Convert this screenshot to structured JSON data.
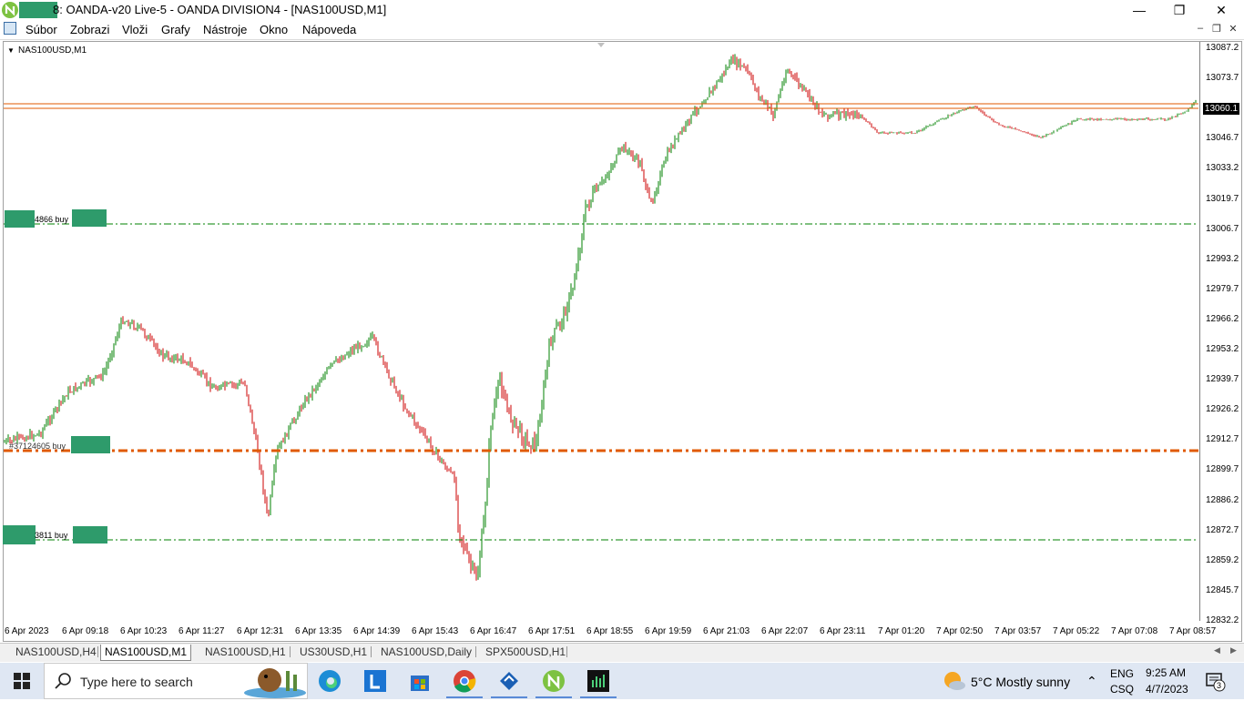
{
  "window": {
    "title": "8: OANDA-v20 Live-5 - OANDA DIVISION4 - [NAS100USD,M1]",
    "minimize": "—",
    "restore": "❐",
    "close": "✕"
  },
  "menu": {
    "items": [
      "Súbor",
      "Zobrazi",
      "Vloži",
      "Grafy",
      "Nástroje",
      "Okno",
      "Nápoveda"
    ],
    "mdi_minimize": "–",
    "mdi_restore": "❐",
    "mdi_close": "✕"
  },
  "chart": {
    "symbol": "NAS100USD,M1",
    "arrow": "▼",
    "current_price": "13060.1",
    "price_axis": [
      "13087.2",
      "13073.7",
      "13060.1",
      "13046.7",
      "13033.2",
      "13019.7",
      "13006.7",
      "12993.2",
      "12979.7",
      "12966.2",
      "12953.2",
      "12939.7",
      "12926.2",
      "12912.7",
      "12899.7",
      "12886.2",
      "12872.7",
      "12859.2",
      "12845.7",
      "12832.2"
    ],
    "time_axis": [
      "6 Apr 2023",
      "6 Apr 09:18",
      "6 Apr 10:23",
      "6 Apr 11:27",
      "6 Apr 12:31",
      "6 Apr 13:35",
      "6 Apr 14:39",
      "6 Apr 15:43",
      "6 Apr 16:47",
      "6 Apr 17:51",
      "6 Apr 18:55",
      "6 Apr 19:59",
      "6 Apr 21:03",
      "6 Apr 22:07",
      "6 Apr 23:11",
      "7 Apr 01:20",
      "7 Apr 02:50",
      "7 Apr 03:57",
      "7 Apr 05:22",
      "7 Apr 07:08",
      "7 Apr 08:57"
    ],
    "orders": [
      {
        "label": "4866 buy",
        "style": "dash-dot"
      },
      {
        "label": "#37124605 buy",
        "style": "thick-dash-dot"
      },
      {
        "label": "3811 buy",
        "style": "dash-dot"
      }
    ],
    "colors": {
      "bull": "#008000",
      "bear": "#cc0000",
      "order_line": "#008000",
      "entry_line": "#e05a00",
      "price_line": "#e05a00"
    }
  },
  "tabs": [
    "NAS100USD,H4",
    "NAS100USD,M1",
    "NAS100USD,H1",
    "US30USD,H1",
    "NAS100USD,Daily",
    "SPX500USD,H1"
  ],
  "active_tab": "NAS100USD,M1",
  "tab_scroll": {
    "left": "◀",
    "right": "▶"
  },
  "taskbar": {
    "search_placeholder": "Type here to search",
    "weather": "5°C  Mostly sunny",
    "language": "ENG",
    "ime": "CSQ",
    "time": "9:25 AM",
    "date": "4/7/2023",
    "notifications": "3"
  }
}
